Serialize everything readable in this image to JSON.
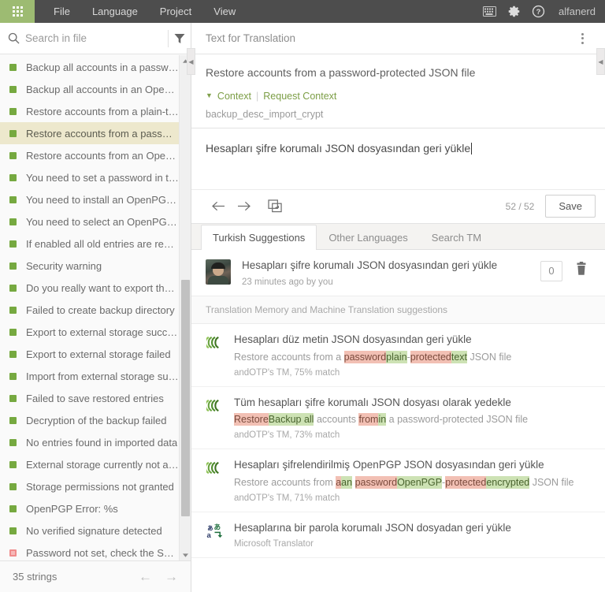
{
  "topbar": {
    "app_launcher_icon": "grid-apps-icon",
    "menu": [
      {
        "label": "File"
      },
      {
        "label": "Language"
      },
      {
        "label": "Project"
      },
      {
        "label": "View"
      }
    ],
    "icons": [
      {
        "name": "keyboard-icon"
      },
      {
        "name": "gear-icon"
      },
      {
        "name": "help-icon"
      }
    ],
    "username": "alfanerd",
    "accent_green": "#9dbb72",
    "bar_bg": "#4d4d4d"
  },
  "sidebar": {
    "search": {
      "placeholder": "Search in file",
      "value": ""
    },
    "filter_icon": "funnel-filter-icon",
    "items": [
      {
        "label": "Backup all accounts in a password-p...",
        "status": "translated",
        "selected": false
      },
      {
        "label": "Backup all accounts in an OpenPGP-...",
        "status": "translated",
        "selected": false
      },
      {
        "label": "Restore accounts from a plain-text JS...",
        "status": "translated",
        "selected": false
      },
      {
        "label": "Restore accounts from a password-p...",
        "status": "translated",
        "selected": true
      },
      {
        "label": "Restore accounts from an OpenPGP-...",
        "status": "translated",
        "selected": false
      },
      {
        "label": "You need to set a password in the Se...",
        "status": "translated",
        "selected": false
      },
      {
        "label": "You need to install an OpenPGP pro...",
        "status": "translated",
        "selected": false
      },
      {
        "label": "You need to select an OpenPGP key i...",
        "status": "translated",
        "selected": false
      },
      {
        "label": "If enabled all old entries are replace...",
        "status": "translated",
        "selected": false
      },
      {
        "label": "Security warning",
        "status": "translated",
        "selected": false
      },
      {
        "label": "Do you really want to export the dat...",
        "status": "translated",
        "selected": false
      },
      {
        "label": "Failed to create backup directory",
        "status": "translated",
        "selected": false
      },
      {
        "label": "Export to external storage successful",
        "status": "translated",
        "selected": false
      },
      {
        "label": "Export to external storage failed",
        "status": "translated",
        "selected": false
      },
      {
        "label": "Import from external storage succes...",
        "status": "translated",
        "selected": false
      },
      {
        "label": "Failed to save restored entries",
        "status": "translated",
        "selected": false
      },
      {
        "label": "Decryption of the backup failed",
        "status": "translated",
        "selected": false
      },
      {
        "label": "No entries found in imported data",
        "status": "translated",
        "selected": false
      },
      {
        "label": "External storage currently not acces...",
        "status": "translated",
        "selected": false
      },
      {
        "label": "Storage permissions not granted",
        "status": "translated",
        "selected": false
      },
      {
        "label": "OpenPGP Error: %s",
        "status": "translated",
        "selected": false
      },
      {
        "label": "No verified signature detected",
        "status": "translated",
        "selected": false
      },
      {
        "label": "Password not set, check the Settings",
        "status": "untranslated",
        "selected": false
      }
    ],
    "footer": {
      "count_label": "35 strings",
      "prev_icon": "arrow-left-icon",
      "next_icon": "arrow-right-icon"
    },
    "status_colors": {
      "translated": "#76a940",
      "untranslated": "#f08c8c"
    }
  },
  "editor": {
    "header_title": "Text for Translation",
    "kebab_icon": "more-options-icon",
    "source_text": "Restore accounts from a password-protected JSON file",
    "context_toggle_label": "Context",
    "request_context_label": "Request Context",
    "context_key": "backup_desc_import_crypt",
    "target_text": "Hesapları şifre korumalı JSON dosyasından geri yükle",
    "toolbar": {
      "back_icon": "arrow-left-icon",
      "forward_icon": "arrow-right-icon",
      "copy_source_icon": "copy-source-icon",
      "counter": "52 / 52",
      "save_label": "Save"
    }
  },
  "tabs": [
    {
      "label": "Turkish Suggestions",
      "active": true
    },
    {
      "label": "Other Languages",
      "active": false
    },
    {
      "label": "Search TM",
      "active": false
    }
  ],
  "suggestions": {
    "user_suggestion": {
      "avatar_name": "user-avatar",
      "text": "Hesapları şifre korumalı JSON dosyasından geri yükle",
      "meta": "23 minutes ago by you",
      "vote_count": "0",
      "delete_icon": "trash-icon"
    },
    "tm_header": "Translation Memory and Machine Translation suggestions",
    "items": [
      {
        "icon": "translation-memory-icon",
        "target": "Hesapları düz metin JSON dosyasından geri yükle",
        "source_parts": [
          {
            "t": "Restore accounts from a ",
            "k": "eq"
          },
          {
            "t": "password",
            "k": "del"
          },
          {
            "t": "plain",
            "k": "ins"
          },
          {
            "t": "-",
            "k": "eq"
          },
          {
            "t": "protected",
            "k": "del"
          },
          {
            "t": "text",
            "k": "ins"
          },
          {
            "t": " JSON file",
            "k": "eq"
          }
        ],
        "meta": "andOTP's TM, 75% match"
      },
      {
        "icon": "translation-memory-icon",
        "target": "Tüm hesapları şifre korumalı JSON dosyası olarak yedekle",
        "source_parts": [
          {
            "t": "Restore",
            "k": "del"
          },
          {
            "t": "Backup all",
            "k": "ins"
          },
          {
            "t": " accounts ",
            "k": "eq"
          },
          {
            "t": "from",
            "k": "del"
          },
          {
            "t": "in",
            "k": "ins"
          },
          {
            "t": " a password-protected JSON file",
            "k": "eq"
          }
        ],
        "meta": "andOTP's TM, 73% match"
      },
      {
        "icon": "translation-memory-icon",
        "target": "Hesapları şifrelendirilmiş OpenPGP JSON dosyasından geri yükle",
        "source_parts": [
          {
            "t": "Restore accounts from ",
            "k": "eq"
          },
          {
            "t": "a",
            "k": "del"
          },
          {
            "t": "an",
            "k": "ins"
          },
          {
            "t": " ",
            "k": "eq"
          },
          {
            "t": "password",
            "k": "del"
          },
          {
            "t": "OpenPGP",
            "k": "ins"
          },
          {
            "t": "-",
            "k": "eq"
          },
          {
            "t": "protected",
            "k": "del"
          },
          {
            "t": "encrypted",
            "k": "ins"
          },
          {
            "t": " JSON file",
            "k": "eq"
          }
        ],
        "meta": "andOTP's TM, 71% match"
      },
      {
        "icon": "machine-translation-icon",
        "target": "Hesaplarına bir parola korumalı JSON dosyadan geri yükle",
        "source_parts": [],
        "meta": "Microsoft Translator"
      }
    ]
  },
  "handles": {
    "left_collapse_icon": "◀",
    "right_collapse_icon": "◀"
  }
}
